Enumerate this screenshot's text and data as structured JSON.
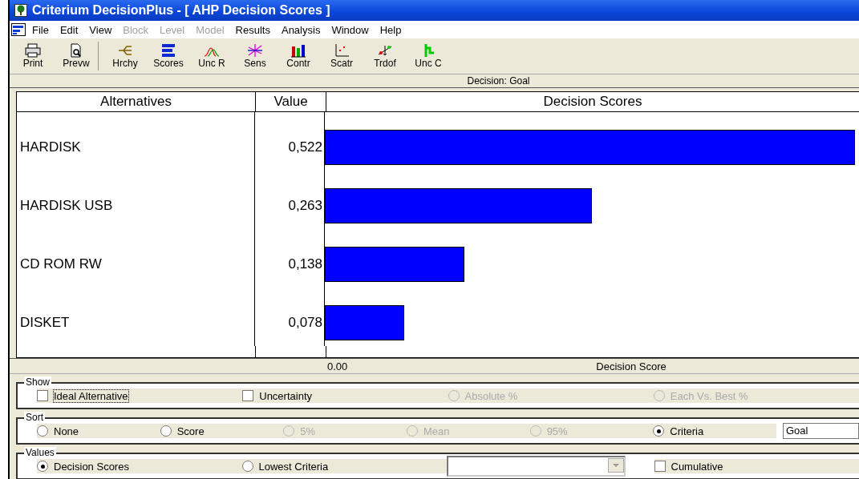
{
  "window": {
    "title": "Criterium DecisionPlus - [ AHP Decision Scores ]"
  },
  "menu": [
    {
      "label": "File",
      "disabled": false
    },
    {
      "label": "Edit",
      "disabled": false
    },
    {
      "label": "View",
      "disabled": false
    },
    {
      "label": "Block",
      "disabled": true
    },
    {
      "label": "Level",
      "disabled": true
    },
    {
      "label": "Model",
      "disabled": true
    },
    {
      "label": "Results",
      "disabled": false
    },
    {
      "label": "Analysis",
      "disabled": false
    },
    {
      "label": "Window",
      "disabled": false
    },
    {
      "label": "Help",
      "disabled": false
    }
  ],
  "toolbar": [
    {
      "label": "Print"
    },
    {
      "label": "Prevw"
    },
    {
      "label": "Hrchy"
    },
    {
      "label": "Scores"
    },
    {
      "label": "Unc R"
    },
    {
      "label": "Sens"
    },
    {
      "label": "Contr"
    },
    {
      "label": "Scatr"
    },
    {
      "label": "Trdof"
    },
    {
      "label": "Unc C"
    }
  ],
  "decision_label": "Decision: Goal",
  "table": {
    "columns": [
      "Alternatives",
      "Value",
      "Decision Scores"
    ],
    "rows": [
      {
        "name": "HARDISK",
        "value": "0,522"
      },
      {
        "name": "HARDISK USB",
        "value": "0,263"
      },
      {
        "name": "CD ROM RW",
        "value": "0,138"
      },
      {
        "name": "DISKET",
        "value": "0,078"
      }
    ],
    "axis": {
      "start_label": "0.00",
      "title": "Decision Score"
    }
  },
  "groups": [
    {
      "title": "Show",
      "items": [
        {
          "kind": "checkbox",
          "label": "Ideal Alternative",
          "checked": false,
          "disabled": false,
          "focused": true
        },
        {
          "kind": "checkbox",
          "label": "Uncertainty",
          "checked": false,
          "disabled": false,
          "focused": false
        },
        {
          "kind": "radio",
          "label": "Absolute %",
          "selected": false,
          "disabled": true,
          "focused": false
        },
        {
          "kind": "radio",
          "label": "Each Vs. Best %",
          "selected": false,
          "disabled": true,
          "focused": false
        }
      ]
    },
    {
      "title": "Sort",
      "items": [
        {
          "kind": "radio",
          "label": "None",
          "selected": false,
          "disabled": false,
          "focused": false
        },
        {
          "kind": "radio",
          "label": "Score",
          "selected": false,
          "disabled": false,
          "focused": false
        },
        {
          "kind": "radio",
          "label": "5%",
          "selected": false,
          "disabled": true,
          "focused": false
        },
        {
          "kind": "radio",
          "label": "Mean",
          "selected": false,
          "disabled": true,
          "focused": false
        },
        {
          "kind": "radio",
          "label": "95%",
          "selected": false,
          "disabled": true,
          "focused": false
        },
        {
          "kind": "radio",
          "label": "Criteria",
          "selected": true,
          "disabled": false,
          "focused": false
        },
        {
          "kind": "field",
          "value": "Goal"
        }
      ]
    },
    {
      "title": "Values",
      "items": [
        {
          "kind": "radio",
          "label": "Decision Scores",
          "selected": true,
          "disabled": false,
          "focused": false
        },
        {
          "kind": "radio",
          "label": "Lowest Criteria",
          "selected": false,
          "disabled": false,
          "focused": false
        },
        {
          "kind": "dropdown"
        },
        {
          "kind": "checkbox",
          "label": "Cumulative",
          "checked": false,
          "disabled": false,
          "focused": false
        }
      ]
    }
  ]
}
